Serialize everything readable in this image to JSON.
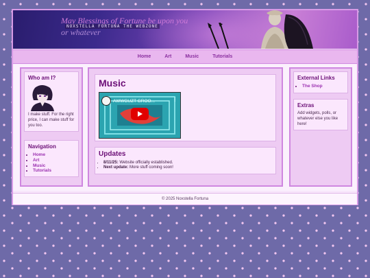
{
  "banner": {
    "title": "May Blessings of Fortune be upon you",
    "subtitle": "NOXSTELLA FORTUNA THE WEBZONE",
    "title_line2": "or whatever"
  },
  "nav": {
    "items": [
      {
        "label": "Home"
      },
      {
        "label": "Art"
      },
      {
        "label": "Music"
      },
      {
        "label": "Tutorials"
      }
    ]
  },
  "left": {
    "who": {
      "heading": "Who am I?",
      "text": "I make stuff. For the right price, I can make stuff for you too."
    },
    "navigation": {
      "heading": "Navigation",
      "items": [
        {
          "label": "Home"
        },
        {
          "label": "Art"
        },
        {
          "label": "Music"
        },
        {
          "label": "Tutorials"
        }
      ]
    }
  },
  "main": {
    "music": {
      "heading": "Music",
      "video_title": "AWWGUZT GROO..."
    },
    "updates": {
      "heading": "Updates",
      "items": [
        {
          "label": "8/11/25:",
          "text": " Website officially established."
        },
        {
          "label": "Next update:",
          "text": " More stuff coming soon!"
        }
      ]
    }
  },
  "right": {
    "links": {
      "heading": "External Links",
      "items": [
        {
          "label": "The Shop"
        }
      ]
    },
    "extras": {
      "heading": "Extras",
      "text": "Add widgets, polls, or whatever else you like here!"
    }
  },
  "footer": {
    "text": "© 2025 Noxstella Fortuna"
  },
  "colors": {
    "accent": "#6c0f77",
    "link": "#9b30b0",
    "background": "#6e6aa8",
    "panel": "#eecbf3"
  }
}
